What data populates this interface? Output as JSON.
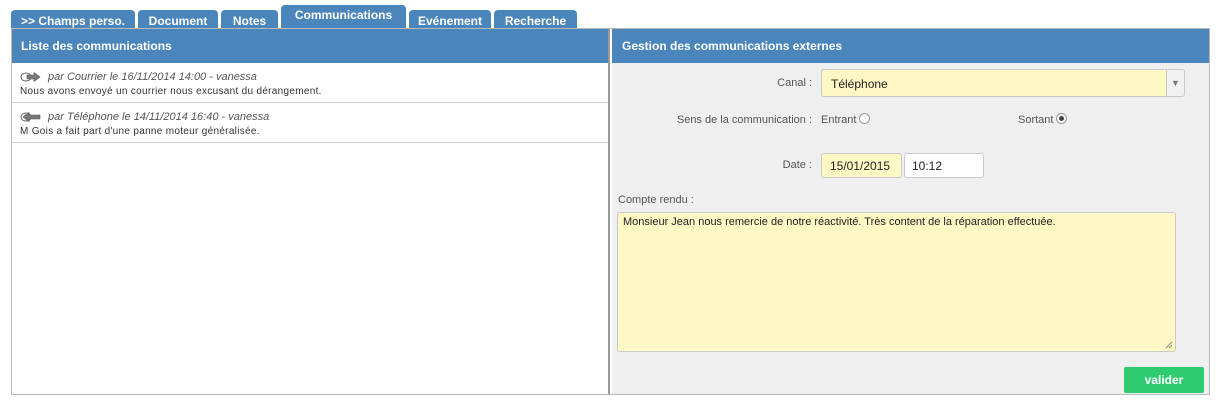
{
  "tabs": [
    {
      "label": ">> Champs perso.",
      "active": false
    },
    {
      "label": "Document",
      "active": false
    },
    {
      "label": "Notes",
      "active": false
    },
    {
      "label": "Communications",
      "active": true
    },
    {
      "label": "Evénement",
      "active": false
    },
    {
      "label": "Recherche",
      "active": false
    }
  ],
  "left_panel": {
    "title": "Liste des communications",
    "items": [
      {
        "meta": "par Courrier le 16/11/2014 14:00 - vanessa",
        "text": "Nous avons envoyé un courrier nous excusant du dérangement.",
        "direction": "outgoing"
      },
      {
        "meta": "par Téléphone le 14/11/2014 16:40 - vanessa",
        "text": "M Gois a fait part d'une panne moteur généralisée.",
        "direction": "incoming"
      }
    ]
  },
  "right_panel": {
    "title": "Gestion des communications externes",
    "canal_label": "Canal :",
    "canal_value": "Téléphone",
    "sens_label": "Sens de la communication :",
    "sens_options": [
      {
        "label": "Entrant",
        "checked": false
      },
      {
        "label": "Sortant",
        "checked": true
      }
    ],
    "date_label": "Date :",
    "date_value": "15/01/2015",
    "time_value": "10:12",
    "compte_rendu_label": "Compte rendu :",
    "compte_rendu_value": "Monsieur Jean nous remercie de notre réactivité. Très content de la réparation effectuée.",
    "submit_label": "valider"
  },
  "colors": {
    "header_blue": "#4a86bb",
    "field_yellow": "#fff8c4",
    "submit_green": "#2ecc71"
  }
}
